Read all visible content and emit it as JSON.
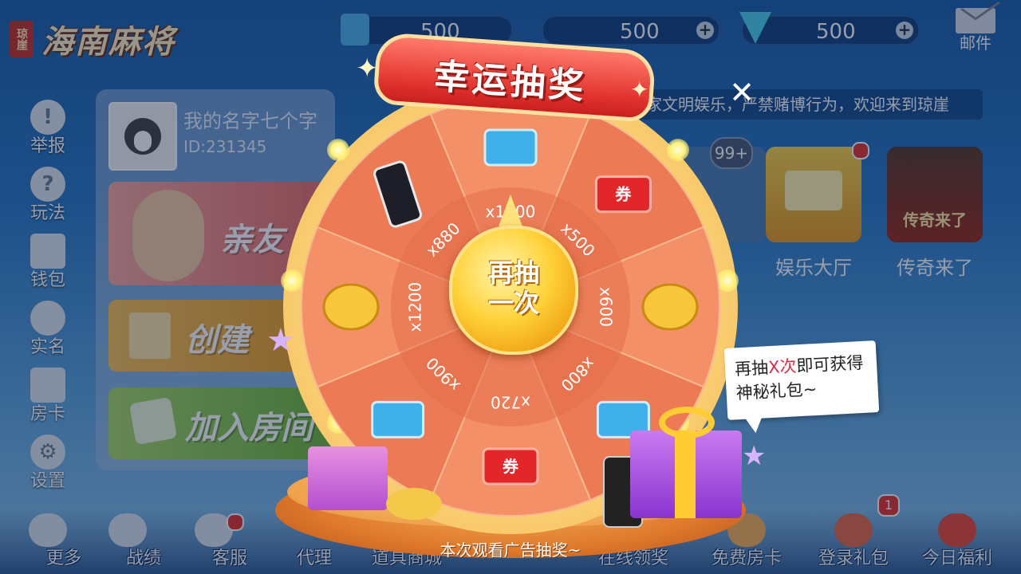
{
  "header": {
    "logo_seal": "琼崖",
    "logo_title": "海南麻将",
    "room_cards": "500",
    "gold": "500",
    "diamonds": "500",
    "mail_label": "邮件"
  },
  "left_menu": [
    "举报",
    "玩法",
    "钱包",
    "实名",
    "房卡",
    "设置"
  ],
  "profile": {
    "name": "我的名字七个字",
    "id": "ID:231345"
  },
  "room_buttons": {
    "friends": "亲友",
    "create": "创建",
    "join": "加入房间"
  },
  "notice": "家文明娱乐，严禁赌博行为，欢迎来到琼崖",
  "games": {
    "badge_count": "99+",
    "entertainment": "娱乐大厅",
    "legend": "传奇来了",
    "legend_art": "传奇来了"
  },
  "bottom_nav": [
    "更多",
    "战绩",
    "客服",
    "代理",
    "道具商城",
    "在线领奖",
    "免费房卡",
    "登录礼包",
    "今日福利"
  ],
  "bottom_badge": "1",
  "lottery": {
    "title": "幸运抽奖",
    "hub_line1": "再抽",
    "hub_line2": "一次",
    "ad_notice": "本次观看广告抽奖~",
    "bubble_prefix": "再抽",
    "bubble_highlight": "X次",
    "bubble_suffix": "即可获得神秘礼包~",
    "coupon_label": "券",
    "segments": [
      {
        "prize": "room-card-icon",
        "amount": "x1000"
      },
      {
        "prize": "coupon-icon",
        "amount": "x500"
      },
      {
        "prize": "gold-coins-icon",
        "amount": "x600"
      },
      {
        "prize": "room-card-icon",
        "amount": "x800"
      },
      {
        "prize": "coupon-icon",
        "amount": "x720"
      },
      {
        "prize": "room-card-icon",
        "amount": "x900"
      },
      {
        "prize": "gold-coins-icon",
        "amount": "x1200"
      },
      {
        "prize": "phone-icon",
        "amount": "x880"
      }
    ]
  }
}
